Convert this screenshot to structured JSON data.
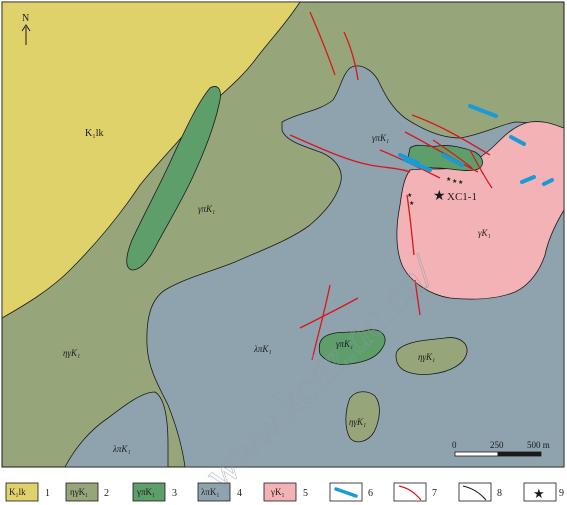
{
  "map": {
    "north_label": "N",
    "units": {
      "k1lk": "K₁lk",
      "eta_gamma": "ηγK₁",
      "gamma_pi": "γπK₁",
      "lambda_pi": "λπK₁",
      "gamma": "γK₁"
    },
    "site_label": "XC1-1",
    "watermark": "www.kcdz.ac.cn/",
    "scale": {
      "zero": "0",
      "mid": "250",
      "end": "500 m"
    }
  },
  "legend": [
    {
      "number": "1",
      "symbol_text": "K₁lk",
      "color": "#e0d26b"
    },
    {
      "number": "2",
      "symbol_text": "ηγK₁",
      "color": "#97a67a"
    },
    {
      "number": "3",
      "symbol_text": "γπK₁",
      "color": "#5e9e6b"
    },
    {
      "number": "4",
      "symbol_text": "λπK₁",
      "color": "#8fa3ae"
    },
    {
      "number": "5",
      "symbol_text": "γK₁",
      "color": "#f3b3b6"
    },
    {
      "number": "6",
      "symbol": "blue-vein"
    },
    {
      "number": "7",
      "symbol": "red-fault"
    },
    {
      "number": "8",
      "symbol": "black-contact"
    },
    {
      "number": "9",
      "symbol": "star-sample"
    }
  ],
  "colors": {
    "k1lk": "#e0d26b",
    "eta_gamma": "#97a67a",
    "gamma_pi": "#5e9e6b",
    "lambda_pi": "#8fa3ae",
    "gamma": "#f3b3b6",
    "vein": "#1a9ad6",
    "fault": "#d9161c",
    "contact": "#1a1a1a"
  }
}
